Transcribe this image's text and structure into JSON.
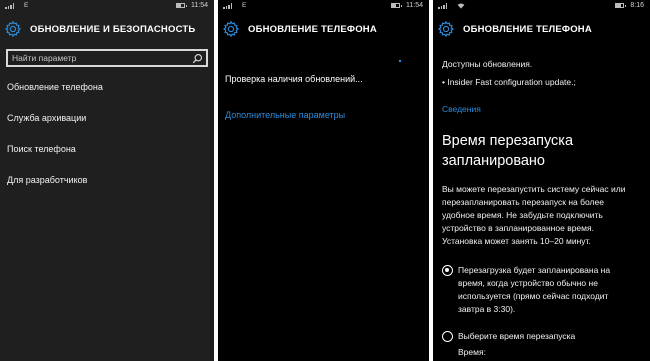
{
  "panel1": {
    "status": {
      "network": "E",
      "time": "11:54"
    },
    "header": {
      "title": "ОБНОВЛЕНИЕ И БЕЗОПАСНОСТЬ",
      "icon": "gear-icon"
    },
    "search": {
      "placeholder": "Найти параметр",
      "icon": "search-icon"
    },
    "menu": [
      "Обновление телефона",
      "Служба архивации",
      "Поиск телефона",
      "Для разработчиков"
    ]
  },
  "panel2": {
    "status": {
      "network": "E",
      "time": "11:54"
    },
    "header": {
      "title": "ОБНОВЛЕНИЕ ТЕЛЕФОНА",
      "icon": "gear-icon"
    },
    "checking_text": "Проверка наличия обновлений...",
    "advanced_link": "Дополнительные параметры"
  },
  "panel3": {
    "status": {
      "time": "8:16"
    },
    "header": {
      "title": "ОБНОВЛЕНИЕ ТЕЛЕФОНА",
      "icon": "gear-icon"
    },
    "available": "Доступны обновления.",
    "update_item": "• Insider Fast configuration update.;",
    "details_link": "Сведения",
    "restart_heading_line1": "Время перезапуска",
    "restart_heading_line2": "запланировано",
    "description": [
      "Вы можете перезапустить систему сейчас или",
      "перезапланировать перезапуск на более",
      "удобное время. Не забудьте подключить",
      "устройство в запланированное время.",
      "Установка может занять 10–20 минут."
    ],
    "option1": [
      "Перезагрузка будет запланирована на",
      "время, когда устройство обычно не",
      "используется (прямо сейчас подходит",
      "завтра в 3:30)."
    ],
    "option2": "Выберите время перезапуска",
    "time_label": "Время:",
    "selected_option": 1
  },
  "colors": {
    "accent": "#2d8bd8",
    "panel1_bg": "#1f1f1f",
    "bg": "#000000"
  }
}
